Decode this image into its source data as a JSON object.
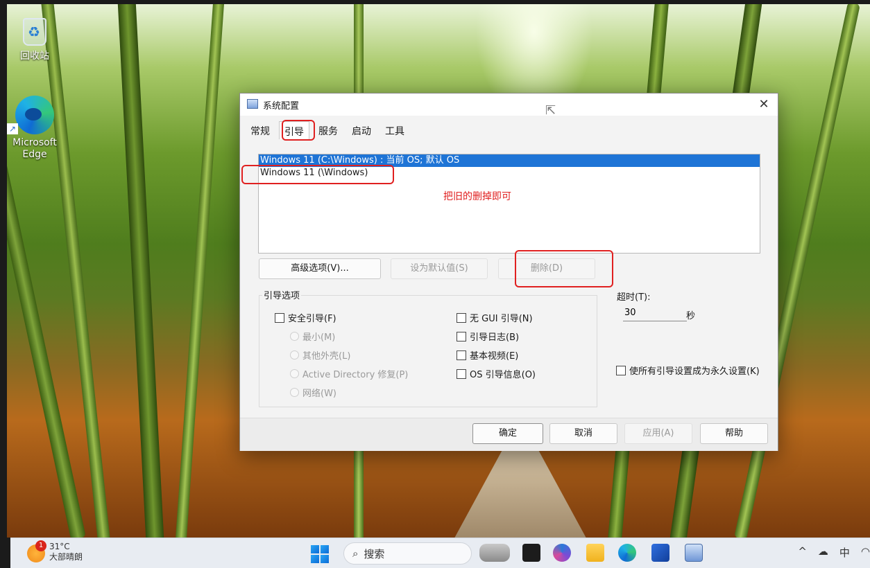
{
  "desktop": {
    "icons": [
      {
        "label": "回收站"
      },
      {
        "label": "Microsoft Edge"
      }
    ]
  },
  "dialog": {
    "title": "系统配置",
    "close": "✕",
    "tabs": [
      "常规",
      "引导",
      "服务",
      "启动",
      "工具"
    ],
    "active_tab": "引导",
    "os_entries": [
      "Windows 11 (C:\\Windows) : 当前 OS; 默认 OS",
      "Windows 11 (\\Windows)"
    ],
    "annotation": "把旧的删掉即可",
    "buttons": {
      "advanced": "高级选项(V)...",
      "set_default": "设为默认值(S)",
      "delete": "删除(D)"
    },
    "boot_options": {
      "title": "引导选项",
      "safe_boot": "安全引导(F)",
      "minimal": "最小(M)",
      "alternate_shell": "其他外壳(L)",
      "ad_repair": "Active Directory 修复(P)",
      "network": "网络(W)",
      "no_gui": "无 GUI 引导(N)",
      "boot_log": "引导日志(B)",
      "base_video": "基本视频(E)",
      "os_info": "OS 引导信息(O)"
    },
    "timeout": {
      "label": "超时(T):",
      "value": "30",
      "unit": "秒"
    },
    "make_permanent": "使所有引导设置成为永久设置(K)",
    "footer": {
      "ok": "确定",
      "cancel": "取消",
      "apply": "应用(A)",
      "help": "帮助"
    }
  },
  "taskbar": {
    "weather_temp": "31°C",
    "weather_desc": "大部晴朗",
    "weather_badge": "1",
    "search_placeholder": "搜索",
    "tray": {
      "chevron": "^",
      "ime": "中"
    }
  },
  "colors": {
    "selection": "#1e74d6",
    "annotation": "#e02020",
    "taskbar": "#e8ecf2"
  }
}
